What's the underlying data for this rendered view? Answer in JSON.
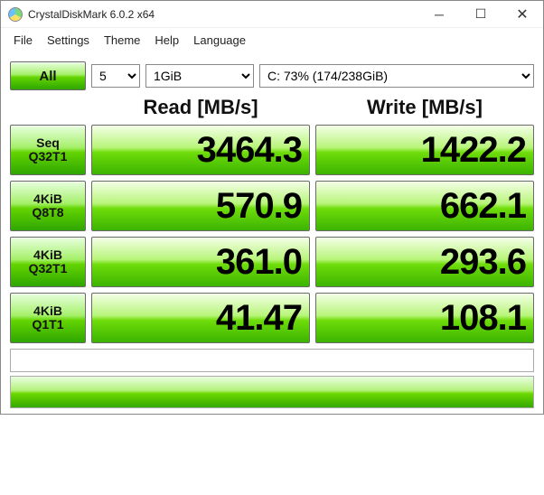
{
  "window": {
    "title": "CrystalDiskMark 6.0.2 x64"
  },
  "menu": {
    "file": "File",
    "settings": "Settings",
    "theme": "Theme",
    "help": "Help",
    "language": "Language"
  },
  "controls": {
    "loops": "5",
    "size": "1GiB",
    "drive": "C: 73% (174/238GiB)"
  },
  "buttons": {
    "all": "All",
    "seq": {
      "l1": "Seq",
      "l2": "Q32T1"
    },
    "k4q8": {
      "l1": "4KiB",
      "l2": "Q8T8"
    },
    "k4q32": {
      "l1": "4KiB",
      "l2": "Q32T1"
    },
    "k4q1": {
      "l1": "4KiB",
      "l2": "Q1T1"
    }
  },
  "headers": {
    "read": "Read [MB/s]",
    "write": "Write [MB/s]"
  },
  "results": {
    "seq": {
      "read": "3464.3",
      "write": "1422.2"
    },
    "k4q8": {
      "read": "570.9",
      "write": "662.1"
    },
    "k4q32": {
      "read": "361.0",
      "write": "293.6"
    },
    "k4q1": {
      "read": "41.47",
      "write": "108.1"
    }
  }
}
